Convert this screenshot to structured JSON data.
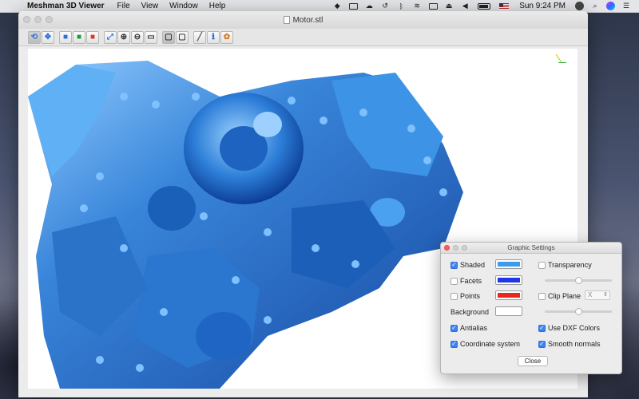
{
  "menubar": {
    "app_name": "Meshman 3D Viewer",
    "items": [
      "File",
      "View",
      "Window",
      "Help"
    ],
    "clock": "Sun 9:24 PM"
  },
  "window": {
    "title": "Motor.stl"
  },
  "toolbar": {
    "groups": [
      [
        "rotate-icon",
        "pan-icon"
      ],
      [
        "cube-front-icon",
        "cube-top-icon",
        "cube-side-icon"
      ],
      [
        "fit-icon",
        "zoom-in-icon",
        "zoom-out-icon",
        "zoom-window-icon"
      ],
      [
        "perspective-icon",
        "ortho-icon"
      ],
      [
        "measure-icon",
        "info-icon",
        "settings-icon"
      ]
    ]
  },
  "viewport": {
    "model_color": "#2e7fd8",
    "background": "#ffffff"
  },
  "settings": {
    "title": "Graphic Settings",
    "shaded": {
      "label": "Shaded",
      "checked": true,
      "color": "#3c9bea"
    },
    "facets": {
      "label": "Facets",
      "checked": false,
      "color": "#1f35e6"
    },
    "points": {
      "label": "Points",
      "checked": false,
      "color": "#e8281d"
    },
    "background": {
      "label": "Background",
      "color": "#ffffff"
    },
    "transparency": {
      "label": "Transparency",
      "checked": false,
      "level": 0.5
    },
    "clip_plane": {
      "label": "Clip Plane",
      "checked": false,
      "axis": "X",
      "level": 0.5
    },
    "antialias": {
      "label": "Antialias",
      "checked": true
    },
    "use_dxf_colors": {
      "label": "Use DXF Colors",
      "checked": true
    },
    "coordinate_system": {
      "label": "Coordinate system",
      "checked": true
    },
    "smooth_normals": {
      "label": "Smooth normals",
      "checked": true
    },
    "close_label": "Close"
  }
}
